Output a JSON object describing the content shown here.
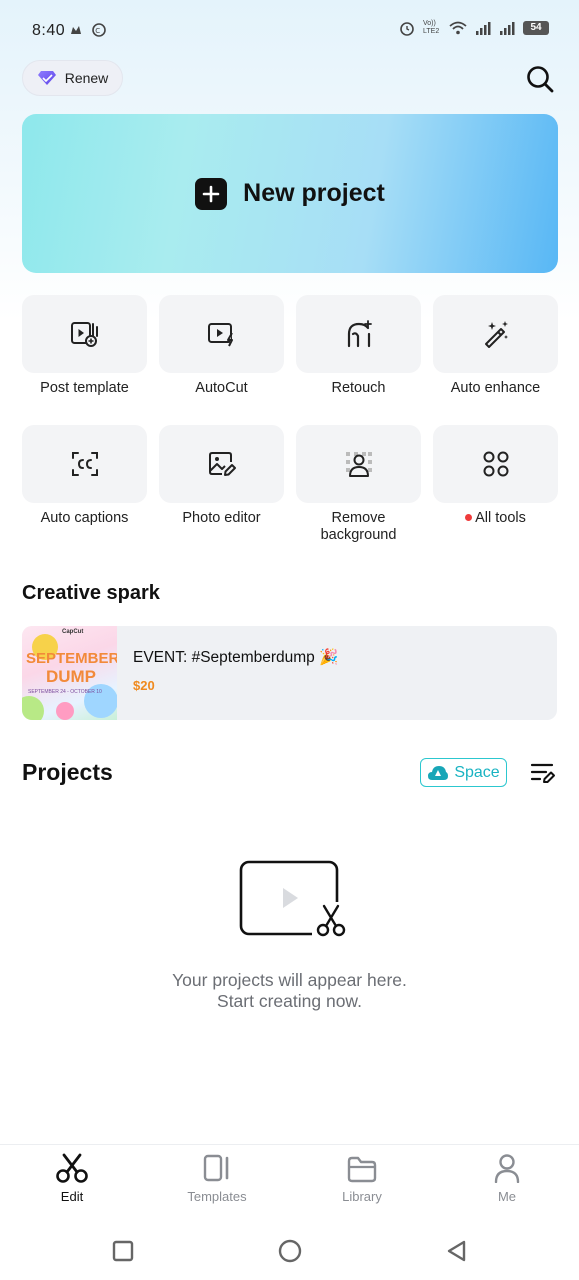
{
  "status_bar": {
    "time": "8:40",
    "network_label": "Vo)) LTE2",
    "battery": "54"
  },
  "header": {
    "renew_label": "Renew",
    "search_icon": "search-icon"
  },
  "hero": {
    "title": "New project",
    "icon": "plus-icon"
  },
  "tools": [
    {
      "label": "Post template",
      "icon": "post-template-icon"
    },
    {
      "label": "AutoCut",
      "icon": "autocut-icon"
    },
    {
      "label": "Retouch",
      "icon": "retouch-icon"
    },
    {
      "label": "Auto enhance",
      "icon": "magic-wand-icon"
    },
    {
      "label": "Auto captions",
      "icon": "captions-icon"
    },
    {
      "label": "Photo editor",
      "icon": "photo-edit-icon"
    },
    {
      "label": "Remove background",
      "icon": "remove-background-icon"
    },
    {
      "label": "All tools",
      "icon": "grid-icon"
    }
  ],
  "creative_spark": {
    "title": "Creative spark",
    "card": {
      "title": "EVENT: #Septemberdump 🎉",
      "price": "$20",
      "thumb_brand": "CapCut",
      "thumb_line1": "SEPTEMBER",
      "thumb_line2": "DUMP",
      "thumb_dates": "SEPTEMBER 24 - OCTOBER 10"
    }
  },
  "projects": {
    "title": "Projects",
    "space_label": "Space",
    "empty_line1": "Your projects will appear here.",
    "empty_line2": "Start creating now."
  },
  "bottom_nav": [
    {
      "label": "Edit",
      "icon": "scissors-icon",
      "active": true
    },
    {
      "label": "Templates",
      "icon": "templates-icon",
      "active": false
    },
    {
      "label": "Library",
      "icon": "folder-icon",
      "active": false
    },
    {
      "label": "Me",
      "icon": "user-icon",
      "active": false
    }
  ],
  "colors": {
    "accent_teal": "#19b3c2",
    "price_orange": "#ef8a1e",
    "notification_dot": "#ef3b3b"
  }
}
